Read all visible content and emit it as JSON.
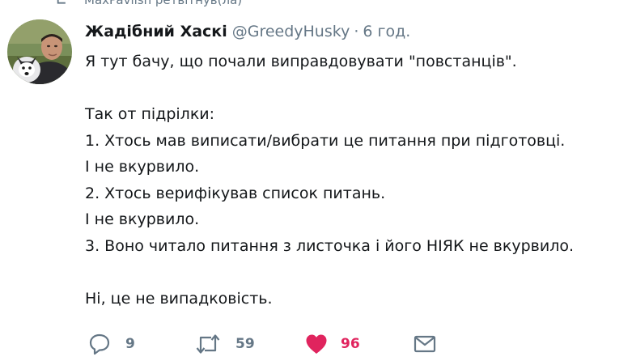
{
  "retweet_context": {
    "text": "MaxPavlish ретвітнув(ла)",
    "icon": "retweet-icon"
  },
  "tweet": {
    "author_name": "Жадібний Хаскі",
    "handle": "@GreedyHusky",
    "separator": "·",
    "timestamp": "6 год.",
    "lines": [
      "Я тут бачу, що почали виправдовувати \"повстанців\".",
      "",
      "Так от підрілки:",
      "1. Хтось мав виписати/вибрати це питання при підготовці.",
      "І не вкурвило.",
      "2. Хтось верифікував список питань.",
      "І не вкурвило.",
      "3. Воно читало питання з листочка і його НІЯК не вкурвило.",
      "",
      "Ні, це не випадковість."
    ]
  },
  "actions": {
    "reply": {
      "icon": "reply-icon",
      "count": "9"
    },
    "retweet": {
      "icon": "retweet-icon",
      "count": "59"
    },
    "like": {
      "icon": "heart-icon",
      "count": "96",
      "liked": true
    },
    "message": {
      "icon": "envelope-icon"
    }
  },
  "colors": {
    "text": "#14171a",
    "secondary": "#657786",
    "like": "#e0245e",
    "background": "#ffffff"
  }
}
